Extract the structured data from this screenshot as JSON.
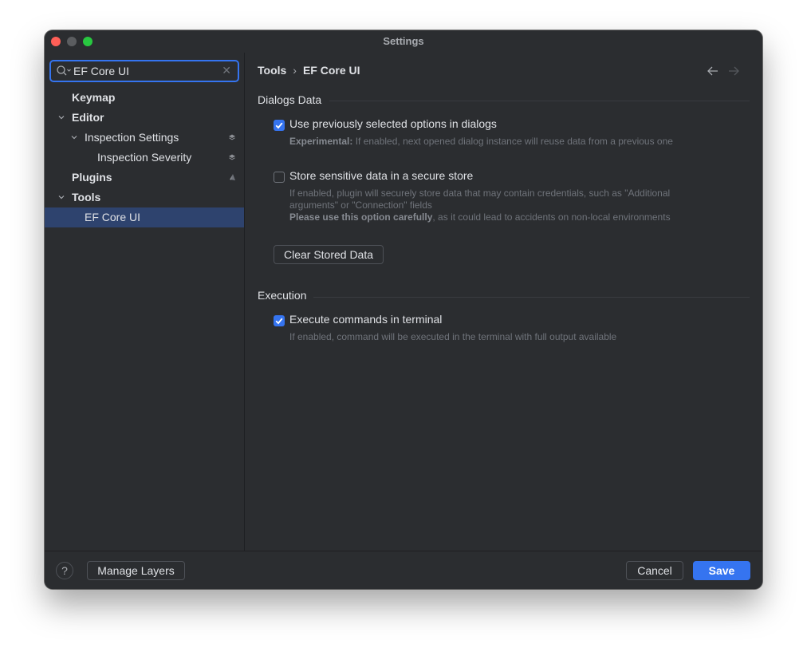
{
  "window": {
    "title": "Settings"
  },
  "search": {
    "value": "EF Core UI"
  },
  "tree": [
    {
      "label": "Keymap"
    },
    {
      "label": "Editor"
    },
    {
      "label": "Inspection Settings"
    },
    {
      "label": "Inspection Severity"
    },
    {
      "label": "Plugins"
    },
    {
      "label": "Tools"
    },
    {
      "label": "EF Core UI"
    }
  ],
  "breadcrumb": {
    "parent": "Tools",
    "sep": "›",
    "current": "EF Core UI"
  },
  "dialogs": {
    "title": "Dialogs Data",
    "option1": {
      "label": "Use previously selected options in dialogs",
      "checked": true,
      "desc_bold": "Experimental:",
      "desc": " If enabled, next opened dialog instance will reuse data from a previous one"
    },
    "option2": {
      "label": "Store sensitive data in a secure store",
      "checked": false,
      "desc": "If enabled, plugin will securely store data that may contain credentials, such as \"Additional arguments\" or \"Connection\" fields",
      "desc2_bold": "Please use this option carefully",
      "desc2": ", as it could lead to accidents on non-local environments"
    },
    "clear_button": "Clear Stored Data"
  },
  "execution": {
    "title": "Execution",
    "option": {
      "label": "Execute commands in terminal",
      "checked": true,
      "desc": "If enabled, command will be executed in the terminal with full output available"
    }
  },
  "footer": {
    "help": "?",
    "manage_layers": "Manage Layers",
    "cancel": "Cancel",
    "save": "Save"
  },
  "colors": {
    "accent": "#3574f0",
    "selection": "#2e436e",
    "background": "#2b2d30"
  }
}
